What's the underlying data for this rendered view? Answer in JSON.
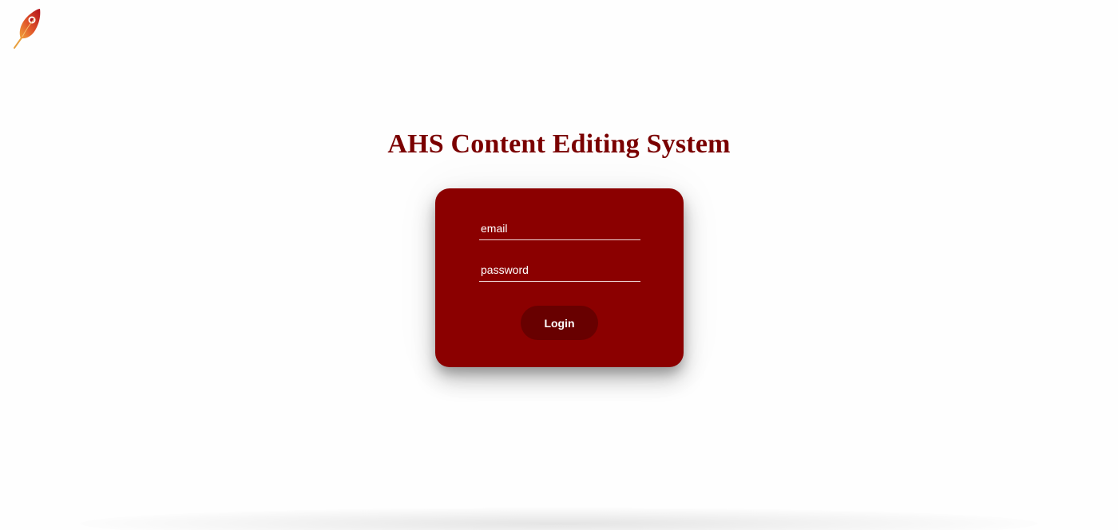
{
  "header": {
    "logo_icon": "feather-logo-icon"
  },
  "main": {
    "title": "AHS Content Editing System"
  },
  "login_form": {
    "email_placeholder": "email",
    "password_placeholder": "password",
    "login_label": "Login"
  },
  "colors": {
    "title": "#7a0000",
    "card_background": "#8b0000",
    "button_background": "#680000",
    "page_background": "#fefefe"
  }
}
